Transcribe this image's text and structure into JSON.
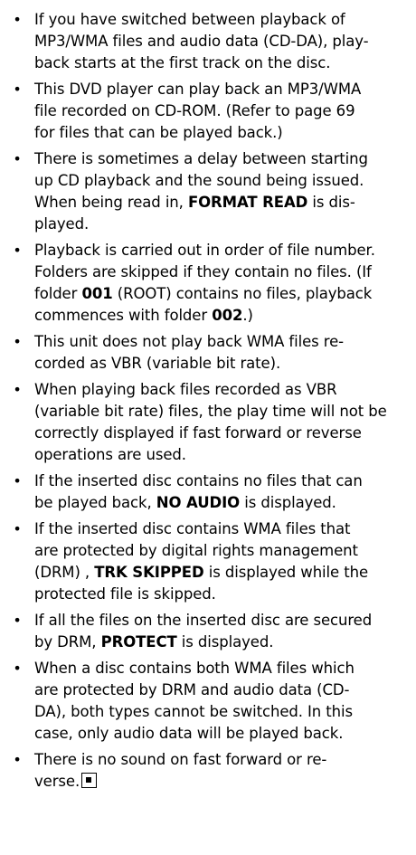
{
  "notes": [
    {
      "lines": [
        [
          {
            "t": "If you have switched between playback of"
          }
        ],
        [
          {
            "t": "MP3/WMA files and audio data (CD-DA), play-"
          }
        ],
        [
          {
            "t": "back starts at the first track on the disc."
          }
        ]
      ]
    },
    {
      "lines": [
        [
          {
            "t": "This DVD player can play back an MP3/WMA"
          }
        ],
        [
          {
            "t": "file recorded on CD-ROM. (Refer to page 69"
          }
        ],
        [
          {
            "t": "for files that can be played back.)"
          }
        ]
      ]
    },
    {
      "lines": [
        [
          {
            "t": "There is sometimes a delay between starting"
          }
        ],
        [
          {
            "t": "up CD playback and the sound being issued."
          }
        ],
        [
          {
            "t": "When being read in, "
          },
          {
            "t": "FORMAT READ",
            "b": true
          },
          {
            "t": " is dis-"
          }
        ],
        [
          {
            "t": "played."
          }
        ]
      ]
    },
    {
      "lines": [
        [
          {
            "t": "Playback is carried out in order of file number."
          }
        ],
        [
          {
            "t": "Folders are skipped if they contain no files. (If"
          }
        ],
        [
          {
            "t": "folder "
          },
          {
            "t": "001",
            "b": true
          },
          {
            "t": " (ROOT) contains no files, playback"
          }
        ],
        [
          {
            "t": "commences with folder "
          },
          {
            "t": "002",
            "b": true
          },
          {
            "t": ".)"
          }
        ]
      ]
    },
    {
      "lines": [
        [
          {
            "t": "This unit does not play back WMA files re-"
          }
        ],
        [
          {
            "t": "corded as VBR (variable bit rate)."
          }
        ]
      ]
    },
    {
      "lines": [
        [
          {
            "t": "When playing back files recorded as VBR"
          }
        ],
        [
          {
            "t": "(variable bit rate) files, the play time will not be"
          }
        ],
        [
          {
            "t": "correctly displayed if fast forward or reverse"
          }
        ],
        [
          {
            "t": "operations are used."
          }
        ]
      ]
    },
    {
      "lines": [
        [
          {
            "t": "If the inserted disc contains no files that can"
          }
        ],
        [
          {
            "t": "be played back, "
          },
          {
            "t": "NO AUDIO",
            "b": true
          },
          {
            "t": " is displayed."
          }
        ]
      ]
    },
    {
      "lines": [
        [
          {
            "t": "If the inserted disc contains WMA files that"
          }
        ],
        [
          {
            "t": "are protected by digital rights management"
          }
        ],
        [
          {
            "t": "(DRM) , "
          },
          {
            "t": "TRK SKIPPED",
            "b": true
          },
          {
            "t": " is displayed while the"
          }
        ],
        [
          {
            "t": "protected file is skipped."
          }
        ]
      ]
    },
    {
      "lines": [
        [
          {
            "t": "If all the files on the inserted disc are secured"
          }
        ],
        [
          {
            "t": "by DRM, "
          },
          {
            "t": "PROTECT",
            "b": true
          },
          {
            "t": " is displayed."
          }
        ]
      ]
    },
    {
      "lines": [
        [
          {
            "t": "When a disc contains both WMA files which"
          }
        ],
        [
          {
            "t": "are protected by DRM and audio data (CD-"
          }
        ],
        [
          {
            "t": "DA), both types cannot be switched. In this"
          }
        ],
        [
          {
            "t": "case, only audio data will be played back."
          }
        ]
      ]
    },
    {
      "lines": [
        [
          {
            "t": "There is no sound on fast forward or re-"
          }
        ],
        [
          {
            "t": "verse."
          }
        ]
      ],
      "end_mark": true
    }
  ]
}
